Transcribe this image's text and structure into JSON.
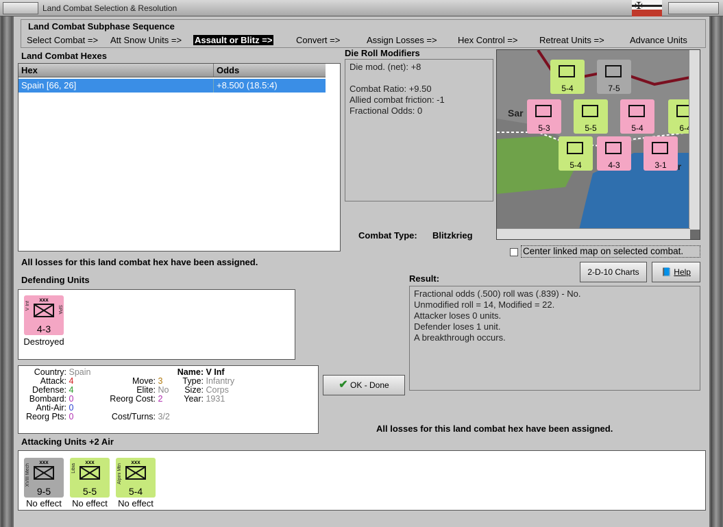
{
  "window": {
    "title": "Land Combat Selection & Resolution"
  },
  "phase": {
    "label": "Land Combat Subphase Sequence",
    "steps": [
      {
        "label": "Select Combat =>",
        "active": false
      },
      {
        "label": "Att Snow Units =>",
        "active": false
      },
      {
        "label": "Assault or Blitz =>",
        "active": true
      },
      {
        "label": "Convert =>",
        "active": false
      },
      {
        "label": "Assign Losses =>",
        "active": false
      },
      {
        "label": "Hex Control =>",
        "active": false
      },
      {
        "label": "Retreat Units =>",
        "active": false
      },
      {
        "label": "Advance Units",
        "active": false
      }
    ]
  },
  "hexes": {
    "label": "Land Combat Hexes",
    "columns": [
      "Hex",
      "Odds"
    ],
    "rows": [
      {
        "hex": "Spain [66, 26]",
        "odds": "+8.500 (18.5:4)"
      }
    ]
  },
  "modifiers": {
    "label": "Die Roll Modifiers",
    "lines": [
      "Die mod. (net): +8",
      "",
      "Combat Ratio: +9.50",
      "Allied combat friction: -1",
      "Fractional Odds: 0"
    ]
  },
  "combat_type": {
    "label": "Combat Type:",
    "value": "Blitzkrieg"
  },
  "center_map": {
    "label": "Center linked map on selected combat."
  },
  "buttons": {
    "charts": "2-D-10 Charts",
    "help": "Help",
    "ok": "OK - Done"
  },
  "losses_msg_left": "All losses for this land combat hex have been assigned.",
  "losses_msg_right": "All losses for this land combat hex have been assigned.",
  "defending": {
    "label": "Defending Units",
    "units": [
      {
        "name": "V Inf",
        "nat": "SPA",
        "size": "xxx",
        "value": "4-3",
        "status": "Destroyed",
        "color": "#f4a6c4"
      }
    ]
  },
  "result": {
    "label": "Result:",
    "lines": [
      "Fractional odds (.500) roll was (.839)  - No.",
      "Unmodified roll = 14, Modified = 22.",
      "Attacker loses 0 units.",
      "Defender loses 1 unit.",
      "A breakthrough occurs."
    ]
  },
  "unit_info": {
    "country_label": "Country:",
    "country": "Spain",
    "attack_label": "Attack:",
    "attack": "4",
    "defense_label": "Defense:",
    "defense": "4",
    "bombard_label": "Bombard:",
    "bombard": "0",
    "antiair_label": "Anti-Air:",
    "antiair": "0",
    "reorgpts_label": "Reorg Pts:",
    "reorgpts": "0",
    "name_label": "Name:",
    "name": "V Inf",
    "move_label": "Move:",
    "move": "3",
    "type_label": "Type:",
    "type": "Infantry",
    "elite_label": "Elite:",
    "elite": "No",
    "size_label": "Size:",
    "size": "Corps",
    "reorgcost_label": "Reorg Cost:",
    "reorgcost": "2",
    "year_label": "Year:",
    "year": "1931",
    "costturns_label": "Cost/Turns:",
    "costturns": "3/2"
  },
  "attacking": {
    "label": "Attacking Units +2 Air",
    "units": [
      {
        "name": "XVIII Mech",
        "size": "xxx",
        "value": "9-5",
        "status": "No effect",
        "color": "#a8a8a8"
      },
      {
        "name": "Libia",
        "size": "xxx",
        "value": "5-5",
        "status": "No effect",
        "color": "#c7e97c"
      },
      {
        "name": "Alpini Mtn",
        "size": "xxx",
        "value": "5-4",
        "status": "No effect",
        "color": "#c7e97c"
      }
    ]
  },
  "map": {
    "labels": [
      "Sar",
      "ar"
    ],
    "counters": [
      {
        "value": "5-4",
        "color": "#c7e97c"
      },
      {
        "value": "7-5",
        "color": "#a8a8a8"
      },
      {
        "value": "5-3",
        "color": "#f4a6c4"
      },
      {
        "value": "5-5",
        "color": "#c7e97c"
      },
      {
        "value": "5-4",
        "color": "#f4a6c4"
      },
      {
        "value": "6-4",
        "color": "#c7e97c"
      },
      {
        "value": "5-4",
        "color": "#c7e97c"
      },
      {
        "value": "4-3",
        "color": "#f4a6c4"
      },
      {
        "value": "3-1",
        "color": "#f4a6c4"
      }
    ]
  }
}
